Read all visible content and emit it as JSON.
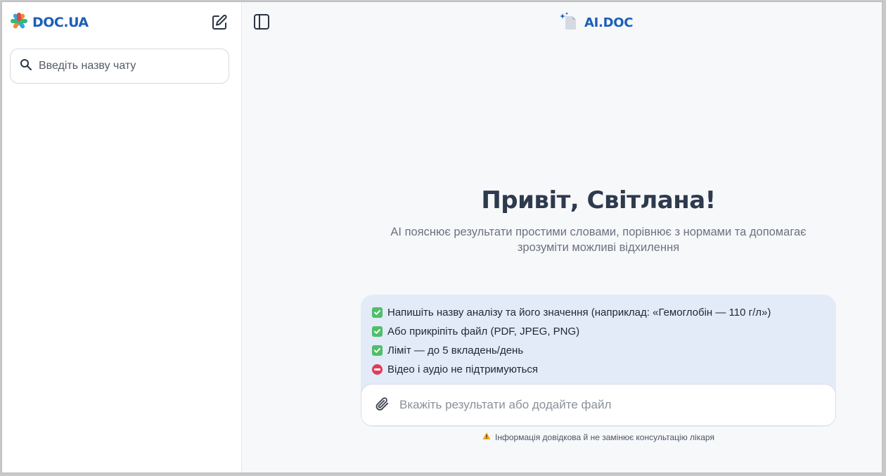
{
  "sidebar": {
    "logo_text": "DOC.UA",
    "new_chat_icon": "edit-icon",
    "search": {
      "placeholder": "Введіть назву чату",
      "value": ""
    }
  },
  "header": {
    "brand_text": "AI.DOC",
    "panel_toggle_icon": "sidebar-toggle-icon"
  },
  "main": {
    "greeting": "Привіт, Світлана!",
    "subtitle_line1": "AI пояснює результати простими словами, порівнює з нормами та допомагає",
    "subtitle_line2": "зрозуміти можливі відхилення",
    "info_items": [
      {
        "icon": "check-icon",
        "text": "Напишіть назву аналізу та його значення (наприклад: «Гемоглобін — 110 г/л»)"
      },
      {
        "icon": "check-icon",
        "text": "Або прикріпіть файл (PDF, JPEG, PNG)"
      },
      {
        "icon": "check-icon",
        "text": "Ліміт — до 5 вкладень/день"
      },
      {
        "icon": "no-entry-icon",
        "text": "Відео і аудіо не підтримуються"
      }
    ],
    "composer": {
      "placeholder": "Вкажіть результати або додайте файл",
      "value": ""
    },
    "disclaimer": "Інформація довідкова й не замінює консультацію лікаря"
  },
  "colors": {
    "brand_blue": "#1b5fb8",
    "card_bg": "#e2ebf7",
    "check_green": "#4fbf6a",
    "no_entry_red": "#e5395a",
    "warning_amber": "#f5a623"
  }
}
